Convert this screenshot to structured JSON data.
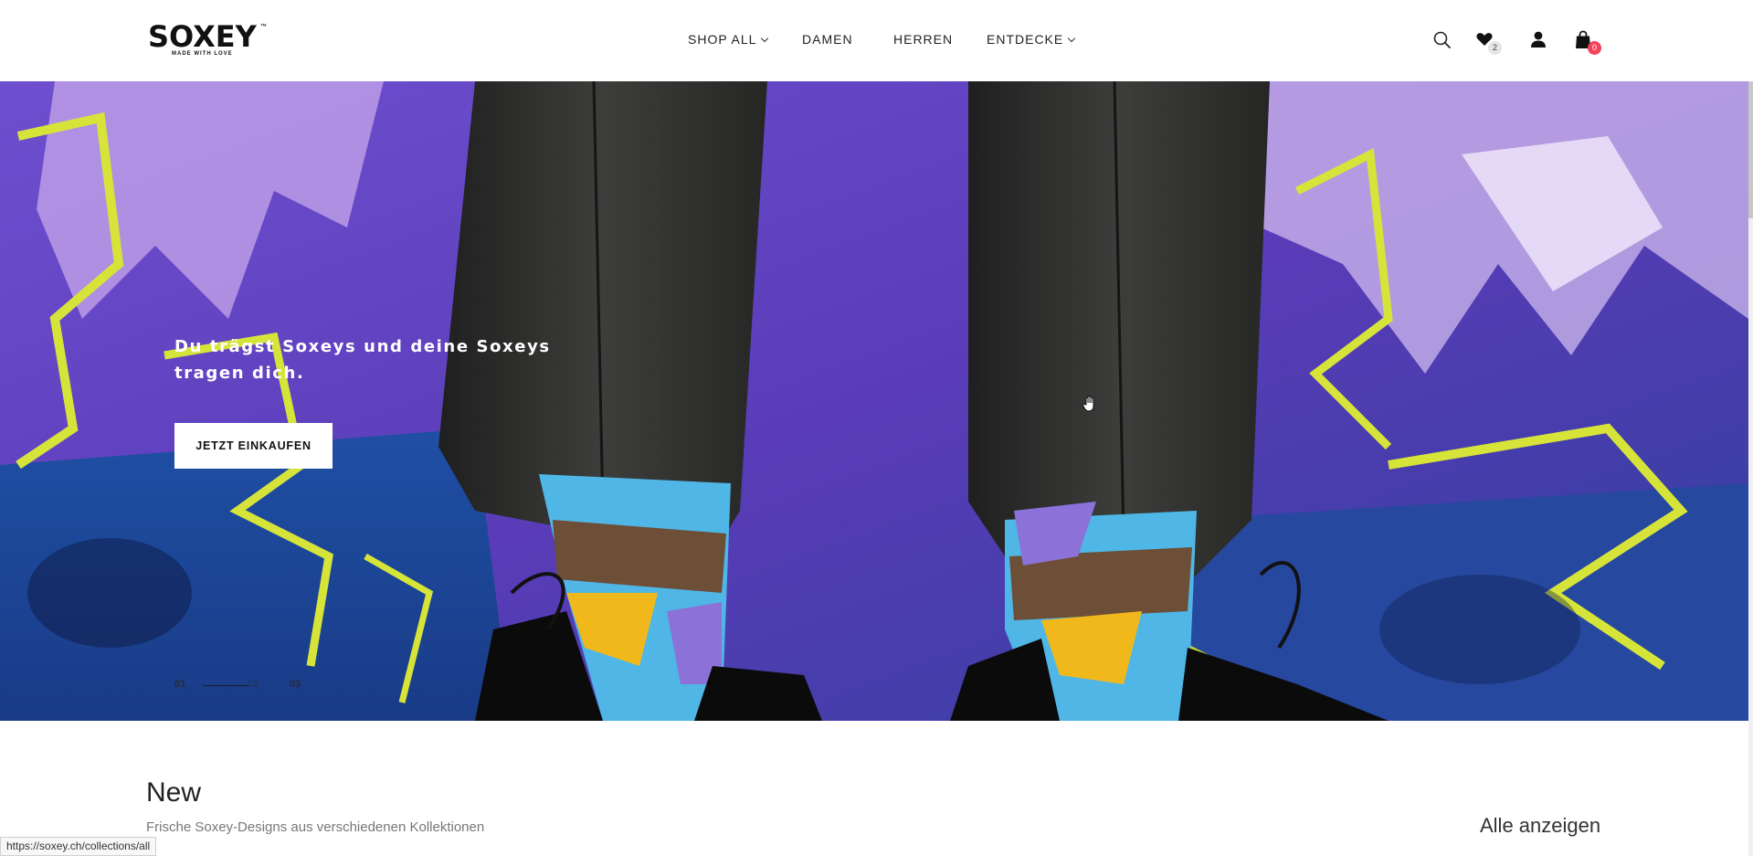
{
  "logo": {
    "wordmark": "SOXEY",
    "tm": "™",
    "tagline": "MADE WITH LOVE"
  },
  "nav": {
    "items": [
      {
        "label": "SHOP ALL",
        "dropdown": true
      },
      {
        "label": "DAMEN",
        "dropdown": false
      },
      {
        "label": "HERREN",
        "dropdown": false
      },
      {
        "label": "ENTDECKE",
        "dropdown": true
      }
    ]
  },
  "header_icons": {
    "search": "search-icon",
    "wishlist": "heart-icon",
    "wishlist_count": "2",
    "account": "user-icon",
    "cart": "bag-icon",
    "cart_count": "0"
  },
  "hero": {
    "title": "Du trägst Soxeys und deine Soxeys tragen dich.",
    "cta_label": "JETZT EINKAUFEN",
    "slides": [
      "01",
      "02",
      "03"
    ],
    "active_slide": 1
  },
  "new_section": {
    "title": "New",
    "subtitle": "Frische Soxey-Designs aus verschiedenen Kollektionen",
    "view_all": "Alle anzeigen"
  },
  "status_bar": {
    "url": "https://soxey.ch/collections/all"
  },
  "colors": {
    "badge_red": "#f4425a",
    "accent_purple": "#6b49c9",
    "graffiti_yellow": "#d6e43a"
  }
}
